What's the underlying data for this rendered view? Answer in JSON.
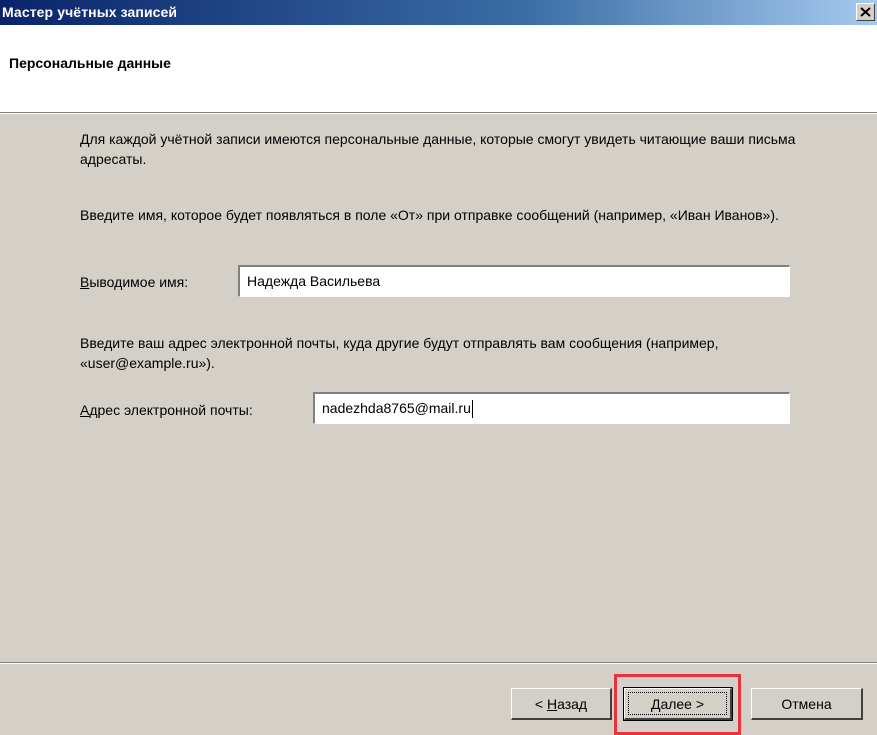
{
  "window": {
    "title": "Мастер учётных записей"
  },
  "header": {
    "title": "Персональные данные"
  },
  "content": {
    "intro": "Для каждой учётной записи имеются персональные данные, которые смогут увидеть читающие ваши письма адресаты.",
    "name_hint": "Введите имя, которое будет появляться в поле «От» при отправке сообщений (например, «Иван Иванов»).",
    "name_label_accel": "В",
    "name_label_rest": "ыводимое имя:",
    "name_value": "Надежда Васильева",
    "email_hint": "Введите ваш адрес электронной почты, куда другие будут отправлять вам сообщения (например, «user@example.ru»).",
    "email_label_accel": "А",
    "email_label_rest": "дрес электронной почты:",
    "email_value": "nadezhda8765@mail.ru"
  },
  "buttons": {
    "back_prefix": "< ",
    "back_accel": "Н",
    "back_rest": "азад",
    "next_accel": "Д",
    "next_rest": "алее >",
    "cancel": "Отмена"
  },
  "colors": {
    "titlebar_start": "#0a246a",
    "titlebar_end": "#a6caf0",
    "dialog_bg": "#d4d0c8",
    "highlight": "#e8323c"
  }
}
